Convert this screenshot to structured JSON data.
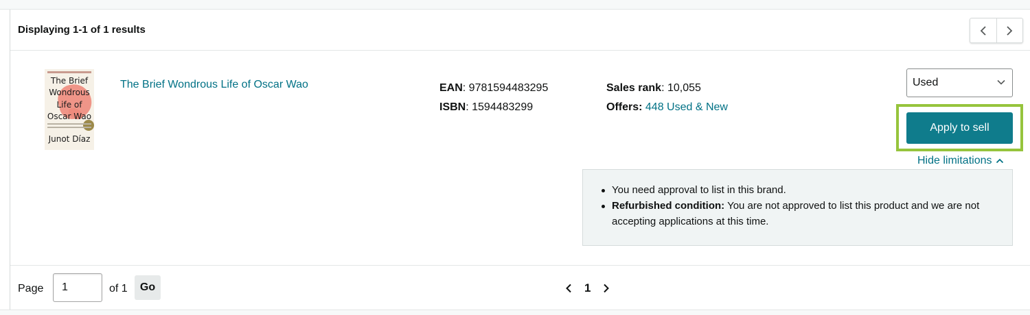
{
  "results_header": {
    "count_text": "Displaying 1-1 of 1 results",
    "prev_icon": "chevron-left-icon",
    "next_icon": "chevron-right-icon"
  },
  "product": {
    "title": "The Brief Wondrous Life of Oscar Wao",
    "cover": {
      "lines": [
        "The Brief",
        "Wondrous",
        "Life of",
        "Oscar Wao",
        "Junot Díaz"
      ],
      "accent_color": "#ee8b7d"
    },
    "ean_label": "EAN",
    "ean_value": "9781594483295",
    "isbn_label": "ISBN",
    "isbn_value": "1594483299",
    "sales_rank_label": "Sales rank",
    "sales_rank_value": "10,055",
    "offers_label": "Offers:",
    "offers_link": "448 Used & New",
    "condition_selected": "Used",
    "apply_button": "Apply to sell",
    "hide_limitations": "Hide limitations",
    "limitations": [
      {
        "bold": "",
        "text": "You need approval to list in this brand."
      },
      {
        "bold": "Refurbished condition:",
        "text": "You are not approved to list this product and we are not accepting applications at this time."
      }
    ]
  },
  "footer": {
    "page_label": "Page",
    "page_value": "1",
    "of_label": "of 1",
    "go_button": "Go",
    "current_page": "1"
  },
  "colors": {
    "link": "#007185",
    "primary_button": "#0f7c8c",
    "highlight": "#96c43c"
  }
}
